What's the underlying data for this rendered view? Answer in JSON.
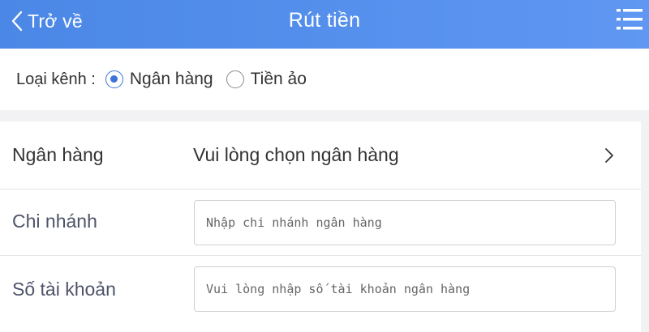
{
  "header": {
    "back_label": "Trở về",
    "title": "Rút tiền",
    "menu_icon": "list-menu-icon",
    "back_icon": "chevron-left-icon",
    "bg_color": "#5590ee"
  },
  "channel": {
    "label": "Loại kênh :",
    "options": [
      {
        "label": "Ngân hàng",
        "checked": true
      },
      {
        "label": "Tiền ảo",
        "checked": false
      }
    ],
    "accent_color": "#3d74d6"
  },
  "form": {
    "bank": {
      "label": "Ngân hàng",
      "value": "Vui lòng chọn ngân hàng",
      "icon": "chevron-right-icon"
    },
    "branch": {
      "label": "Chi nhánh",
      "placeholder": "Nhập chi nhánh ngân hàng",
      "value": ""
    },
    "account": {
      "label": "Số tài khoản",
      "placeholder": "Vui lòng nhập số tài khoản ngân hàng",
      "value": ""
    }
  }
}
